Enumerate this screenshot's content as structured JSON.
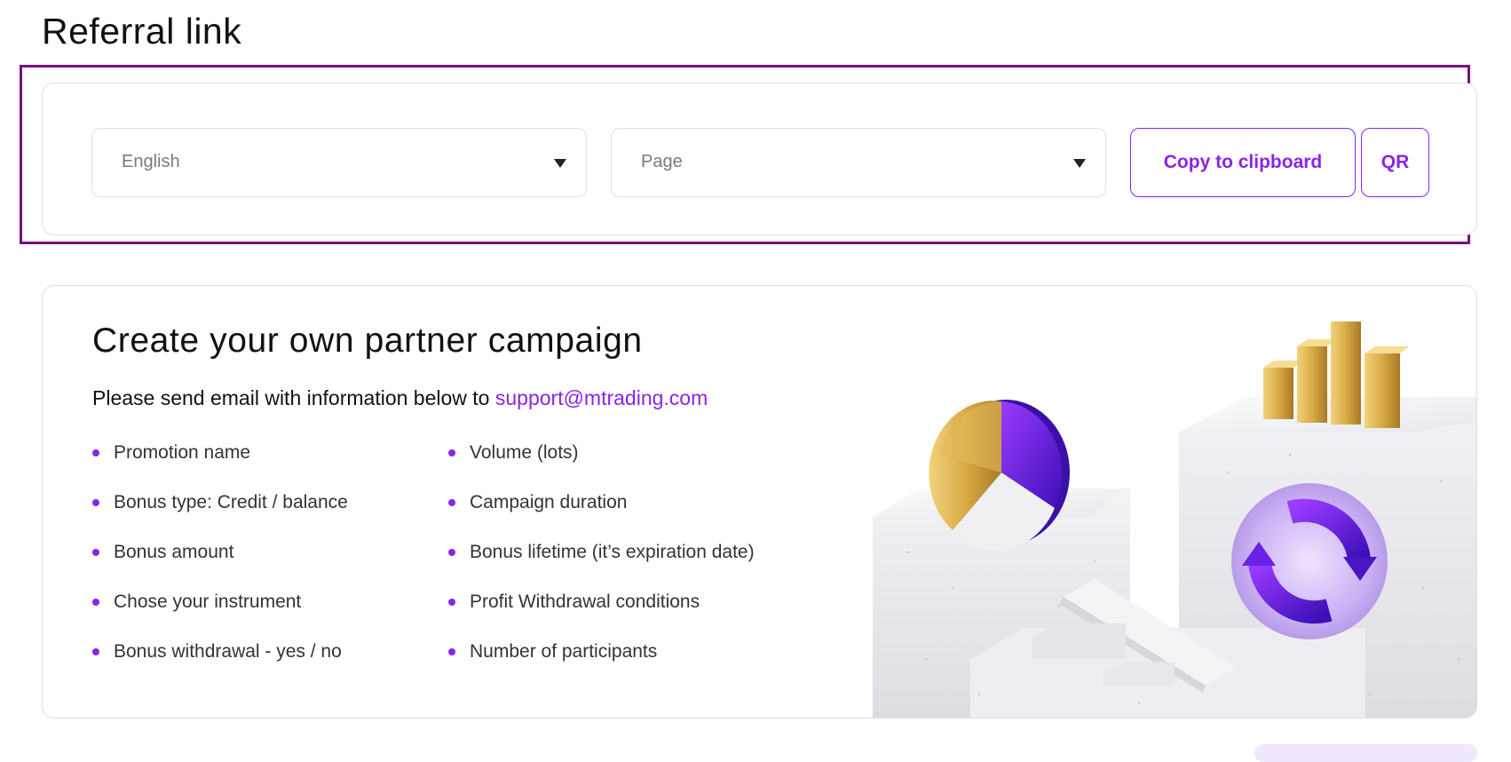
{
  "page_title": "Referral link",
  "referral": {
    "language_select": {
      "value": "English"
    },
    "page_select": {
      "value": "Page"
    },
    "copy_button": "Copy to clipboard",
    "qr_button": "QR"
  },
  "campaign": {
    "title": "Create your own partner campaign",
    "intro_text": "Please send email with information below to",
    "support_email": "support@mtrading.com",
    "left_items": [
      "Promotion name",
      "Bonus type: Credit / balance",
      "Bonus amount",
      "Chose your instrument",
      "Bonus withdrawal - yes / no"
    ],
    "right_items": [
      "Volume (lots)",
      "Campaign duration",
      "Bonus lifetime (it’s expiration date)",
      "Profit Withdrawal conditions",
      "Number of participants"
    ]
  },
  "colors": {
    "accent": "#8a24e6",
    "highlight_frame": "#7a0f7e",
    "gold": "#d4a843",
    "card_border": "#dedede"
  }
}
